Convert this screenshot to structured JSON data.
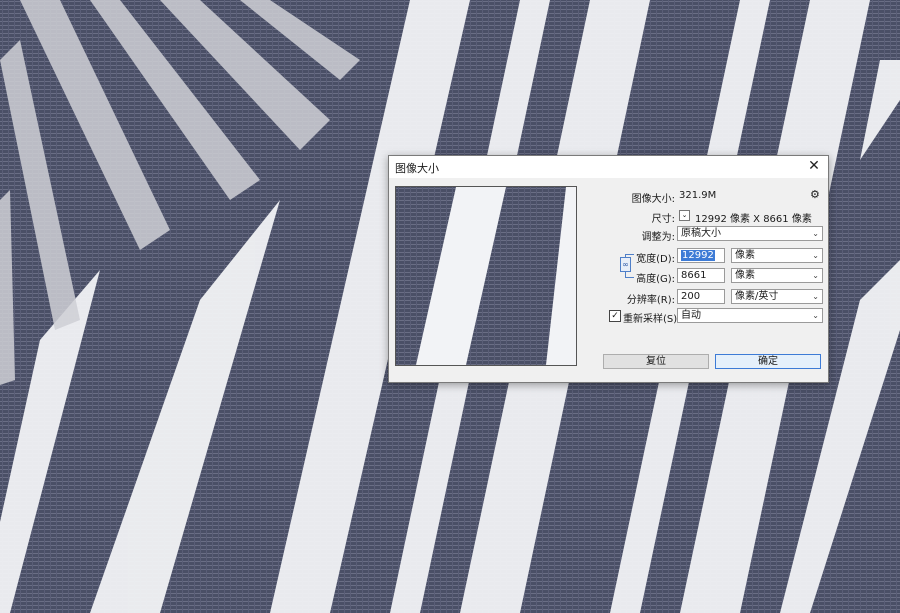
{
  "dialog": {
    "title": "图像大小",
    "close_glyph": "✕",
    "image_size_label": "图像大小:",
    "image_size_value": "321.9M",
    "dimensions_label": "尺寸:",
    "dimensions_value": "12992 像素  X  8661 像素",
    "fit_to_label": "调整为:",
    "fit_to_value": "原稿大小",
    "width_label": "宽度(D):",
    "width_value": "12992",
    "width_unit": "像素",
    "height_label": "高度(G):",
    "height_value": "8661",
    "height_unit": "像素",
    "resolution_label": "分辨率(R):",
    "resolution_value": "200",
    "resolution_unit": "像素/英寸",
    "resample_label": "重新采样(S):",
    "resample_checked": true,
    "resample_value": "自动",
    "reset_button": "复位",
    "ok_button": "确定",
    "check_glyph": "✓",
    "dropdown_glyph": "⌄",
    "gear_glyph": "⚙",
    "link_glyph": "∞"
  },
  "icons": {
    "close": "close-icon",
    "gear": "gear-icon",
    "link": "chain-link-icon",
    "dropdown": "chevron-down-icon"
  },
  "colors": {
    "canvas_dark": "#4a4f66",
    "canvas_light": "#ffffff",
    "accent": "#3d7bd6"
  }
}
